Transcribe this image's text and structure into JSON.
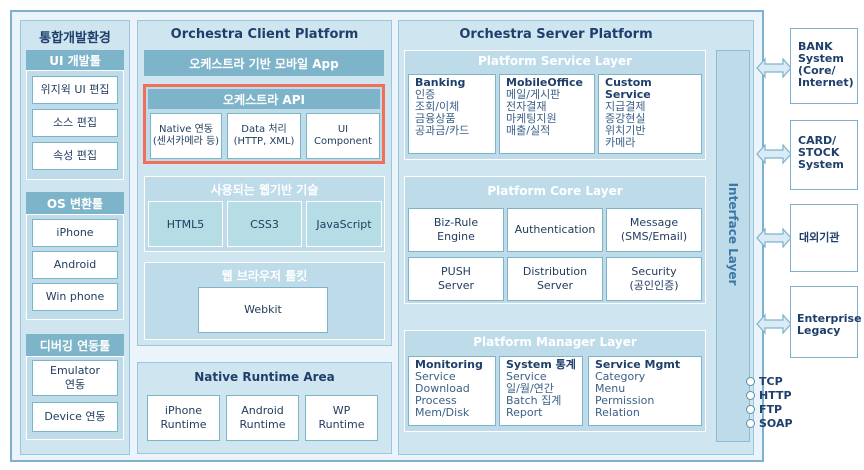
{
  "left": {
    "title": "통합개발환경",
    "ui_tools": {
      "title": "UI 개발툴",
      "items": [
        "위지윅 UI 편집",
        "소스 편집",
        "속성 편집"
      ]
    },
    "os_tools": {
      "title": "OS 변환툴",
      "items": [
        "iPhone",
        "Android",
        "Win phone"
      ]
    },
    "debug_tools": {
      "title": "디버깅 연동툴",
      "items": [
        "Emulator\n연동",
        "Device 연동"
      ]
    }
  },
  "client": {
    "title": "Orchestra Client Platform",
    "mobile_app": "오케스트라 기반 모바일 App",
    "api": {
      "title": "오케스트라 API",
      "items": [
        "Native 연동\n(센서카메라 등)",
        "Data 처리\n(HTTP, XML)",
        "UI\nComponent"
      ]
    },
    "web_tech": {
      "title": "사용되는 웹기반 기술",
      "items": [
        "HTML5",
        "CSS3",
        "JavaScript"
      ]
    },
    "browser": {
      "title": "웹 브라우저 툴킷",
      "item": "Webkit"
    },
    "runtime": {
      "title": "Native Runtime Area",
      "items": [
        "iPhone\nRuntime",
        "Android\nRuntime",
        "WP\nRuntime"
      ]
    }
  },
  "server": {
    "title": "Orchestra Server Platform",
    "service_layer": {
      "title": "Platform Service Layer",
      "groups": [
        {
          "title": "Banking",
          "lines": [
            "인증",
            "조회/이체",
            "금융상품",
            "공과금/카드"
          ]
        },
        {
          "title": "MobileOffice",
          "lines": [
            "메일/게시판",
            "전자결재",
            "마케팅지원",
            "매출/실적"
          ]
        },
        {
          "title": "Custom Service",
          "lines": [
            "지급결제",
            "증강현실",
            "위치기반",
            "카메라"
          ]
        }
      ]
    },
    "core_layer": {
      "title": "Platform Core Layer",
      "items": [
        "Biz-Rule\nEngine",
        "Authentication",
        "Message\n(SMS/Email)",
        "PUSH\nServer",
        "Distribution\nServer",
        "Security\n(공인인증)"
      ]
    },
    "manager_layer": {
      "title": "Platform Manager Layer",
      "groups": [
        {
          "title": "Monitoring",
          "lines": [
            "Service",
            "Download",
            "Process",
            "Mem/Disk"
          ]
        },
        {
          "title": "System 통계",
          "lines": [
            "Service",
            "일/월/연간",
            "Batch 집계",
            "Report"
          ]
        },
        {
          "title": "Service Mgmt",
          "lines": [
            "Category",
            "Menu",
            "Permission",
            "Relation"
          ]
        }
      ]
    },
    "interface_layer": "Interface Layer"
  },
  "external": [
    {
      "label": "BANK\nSystem\n(Core/\nInternet)"
    },
    {
      "label": "CARD/\nSTOCK\nSystem"
    },
    {
      "label": "대외기관"
    },
    {
      "label": "Enterprise\nLegacy"
    }
  ],
  "protocols": [
    "TCP",
    "HTTP",
    "FTP",
    "SOAP"
  ],
  "colors": {
    "highlight": "#f0705a",
    "band": "#7eb4ca",
    "frame": "#7fb1cf"
  }
}
